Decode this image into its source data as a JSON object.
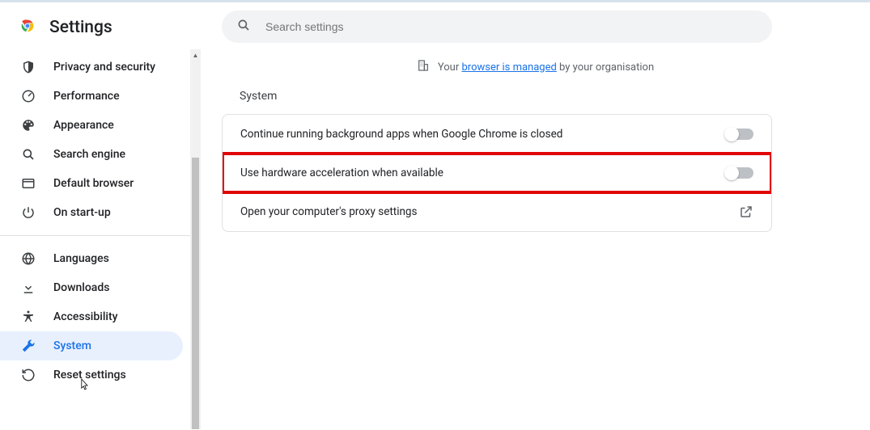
{
  "header": {
    "title": "Settings"
  },
  "search": {
    "placeholder": "Search settings"
  },
  "managed": {
    "prefix": "Your ",
    "link": "browser is managed",
    "suffix": " by your organisation"
  },
  "sidebar": {
    "group1": [
      {
        "icon": "shield-icon",
        "label": "Privacy and security"
      },
      {
        "icon": "speedometer-icon",
        "label": "Performance"
      },
      {
        "icon": "palette-icon",
        "label": "Appearance"
      },
      {
        "icon": "search-icon",
        "label": "Search engine"
      },
      {
        "icon": "browser-icon",
        "label": "Default browser"
      },
      {
        "icon": "power-icon",
        "label": "On start-up"
      }
    ],
    "group2": [
      {
        "icon": "globe-icon",
        "label": "Languages"
      },
      {
        "icon": "download-icon",
        "label": "Downloads"
      },
      {
        "icon": "accessibility-icon",
        "label": "Accessibility"
      },
      {
        "icon": "wrench-icon",
        "label": "System",
        "active": true
      },
      {
        "icon": "reset-icon",
        "label": "Reset settings"
      }
    ]
  },
  "section": {
    "title": "System",
    "rows": [
      {
        "label": "Continue running background apps when Google Chrome is closed",
        "control": "toggle",
        "value": false
      },
      {
        "label": "Use hardware acceleration when available",
        "control": "toggle",
        "value": false,
        "highlight": true
      },
      {
        "label": "Open your computer's proxy settings",
        "control": "external"
      }
    ]
  }
}
